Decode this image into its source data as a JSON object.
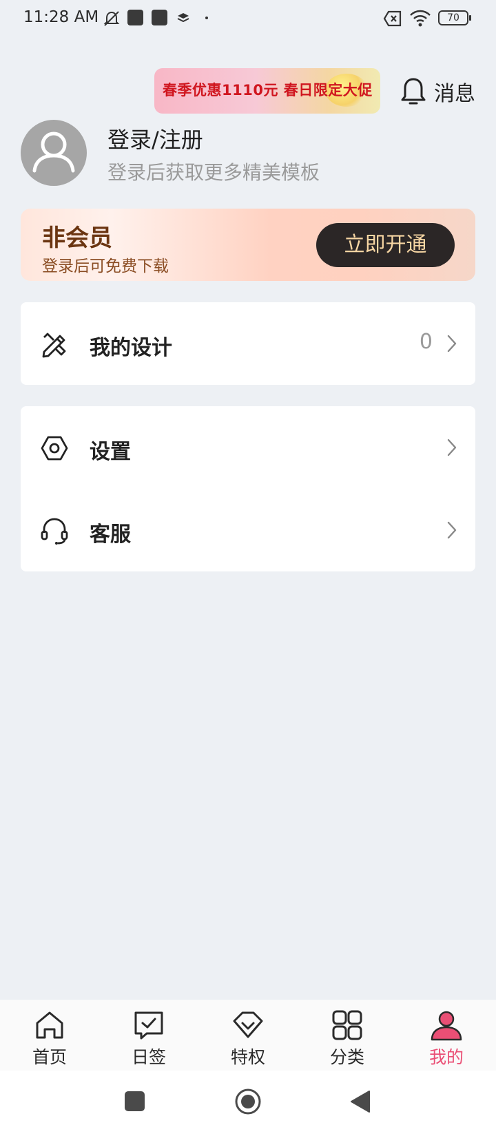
{
  "status_bar": {
    "time": "11:28 AM",
    "battery": "70",
    "icons": [
      "muted-notifications-icon",
      "app-notification-icon",
      "app-notification-icon",
      "layers-icon",
      "dot-icon",
      "no-sim-icon",
      "wifi-icon",
      "battery-icon"
    ]
  },
  "header": {
    "promo_text": "春季优惠1110元 春日限定大促",
    "messages_label": "消息",
    "messages_icon": "bell-icon"
  },
  "profile": {
    "title": "登录/注册",
    "subtitle": "登录后获取更多精美模板",
    "avatar_icon": "user-avatar-icon"
  },
  "vip_card": {
    "title": "非会员",
    "subtitle": "登录后可免费下载",
    "button_label": "立即开通"
  },
  "menu": {
    "my_designs": {
      "label": "我的设计",
      "count": "0",
      "icon": "design-pencil-icon"
    },
    "settings": {
      "label": "设置",
      "icon": "hexagon-settings-icon"
    },
    "customer_service": {
      "label": "客服",
      "icon": "headset-icon"
    }
  },
  "bottom_nav": {
    "items": [
      {
        "label": "首页",
        "icon": "home-icon"
      },
      {
        "label": "日签",
        "icon": "check-message-icon"
      },
      {
        "label": "特权",
        "icon": "diamond-icon"
      },
      {
        "label": "分类",
        "icon": "grid-icon"
      },
      {
        "label": "我的",
        "icon": "profile-icon"
      }
    ],
    "active_index": 4
  },
  "colors": {
    "accent": "#ea4f75",
    "promo_text": "#d0161f",
    "vip_title": "#6b3511",
    "vip_button": "#2b2626",
    "vip_button_text": "#f7d6a3",
    "page_background": "#edf0f4"
  },
  "system_nav": {
    "icons": [
      "recent-apps-icon",
      "home-circle-icon",
      "back-icon"
    ]
  }
}
